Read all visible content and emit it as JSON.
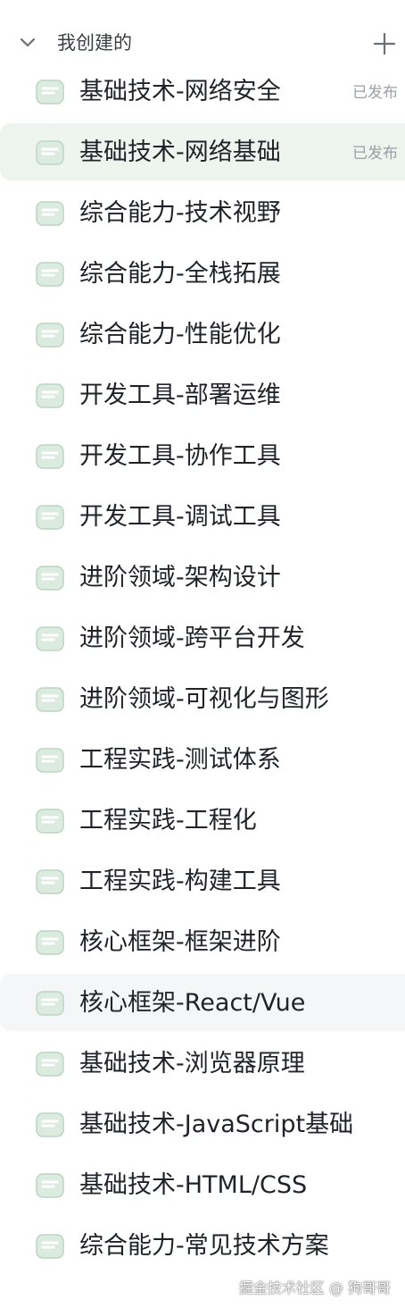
{
  "section": {
    "title": "我创建的",
    "collapse_icon": "chevron-down-icon",
    "add_icon": "plus-icon"
  },
  "colors": {
    "icon_fill": "#dcebe0",
    "icon_stroke": "#bcd6c3",
    "selected_bg": "#eef4ee",
    "hover_bg": "#f5f6f7",
    "status_text": "#9aa0a6"
  },
  "items": [
    {
      "label": "基础技术-网络安全",
      "status": "已发布"
    },
    {
      "label": "基础技术-网络基础",
      "status": "已发布",
      "selected": true
    },
    {
      "label": "综合能力-技术视野"
    },
    {
      "label": "综合能力-全栈拓展"
    },
    {
      "label": "综合能力-性能优化"
    },
    {
      "label": "开发工具-部署运维"
    },
    {
      "label": "开发工具-协作工具"
    },
    {
      "label": "开发工具-调试工具"
    },
    {
      "label": "进阶领域-架构设计"
    },
    {
      "label": "进阶领域-跨平台开发"
    },
    {
      "label": "进阶领域-可视化与图形"
    },
    {
      "label": "工程实践-测试体系"
    },
    {
      "label": "工程实践-工程化"
    },
    {
      "label": "工程实践-构建工具"
    },
    {
      "label": "核心框架-框架进阶"
    },
    {
      "label": "核心框架-React/Vue",
      "hover": true
    },
    {
      "label": "基础技术-浏览器原理"
    },
    {
      "label": "基础技术-JavaScript基础"
    },
    {
      "label": "基础技术-HTML/CSS"
    },
    {
      "label": "综合能力-常见技术方案"
    }
  ],
  "watermark": "掘金技术社区 @ 狗哥哥"
}
